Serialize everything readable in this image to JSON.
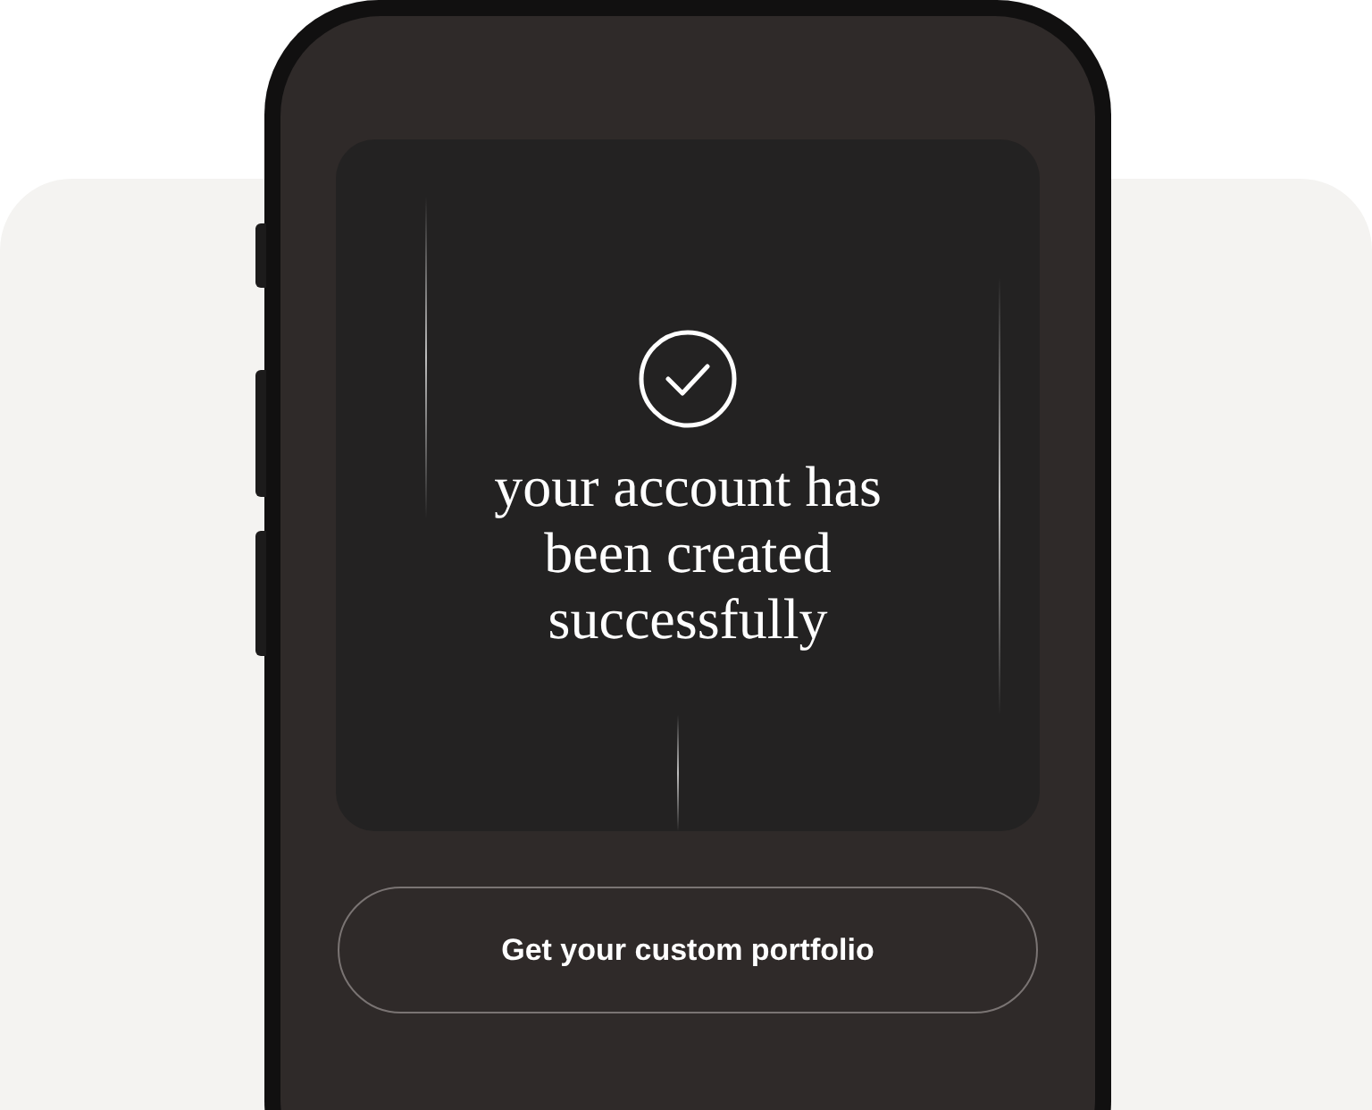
{
  "screen": {
    "message": "your account has been created successfully",
    "button": {
      "label": "Get your custom portfolio"
    }
  }
}
